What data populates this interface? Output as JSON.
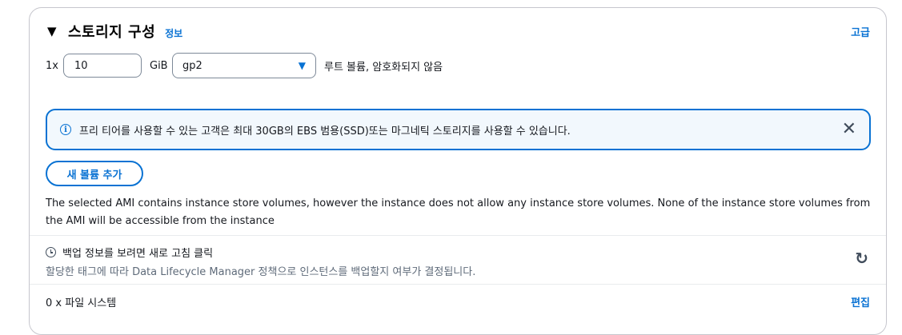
{
  "section": {
    "caret": "▼",
    "title": "스토리지 구성",
    "info_link": "정보",
    "advanced_link": "고급"
  },
  "volume": {
    "multiplier": "1x",
    "size_value": "10",
    "unit": "GiB",
    "volume_type": "gp2",
    "description": "루트 볼륨,  암호화되지 않음"
  },
  "alert": {
    "message": "프리 티어를 사용할 수 있는 고객은 최대 30GB의 EBS 범용(SSD)또는 마그네틱 스토리지를 사용할 수 있습니다.",
    "close_glyph": "✕"
  },
  "add_volume_button": "새 볼륨 추가",
  "instance_store_notice": "The selected AMI contains instance store volumes, however the instance does not allow any instance store volumes. None of the instance store volumes from the AMI will be accessible from the instance",
  "backup": {
    "heading": "백업 정보를 보려면 새로 고침 클릭",
    "subtext": "할당한 태그에 따라 Data Lifecycle Manager 정책으로 인스턴스를 백업할지 여부가 결정됩니다.",
    "refresh_glyph": "↻"
  },
  "file_systems": {
    "label": "0 x 파일 시스템",
    "edit_link": "편집"
  },
  "colors": {
    "link": "#0972d3",
    "alert_bg": "#f2f8fd",
    "border": "#c6c6cd"
  }
}
